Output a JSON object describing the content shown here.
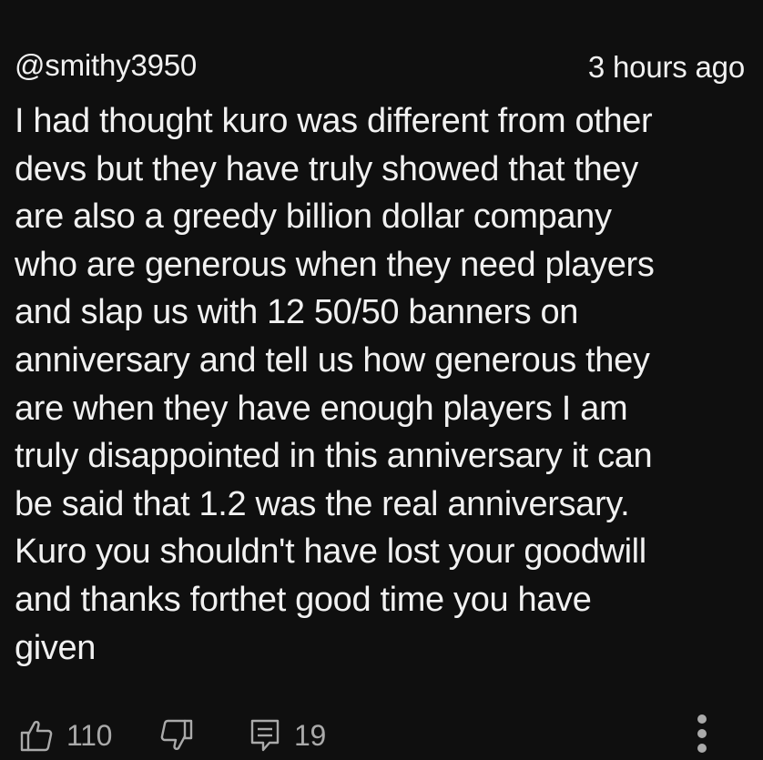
{
  "comment": {
    "author": "@smithy3950",
    "timestamp": "3 hours ago",
    "text": "I had thought kuro was different from other\ndevs but they have truly showed that they\nare also a greedy billion dollar company\nwho are generous when they need players\nand slap us with 12 50/50 banners on\nanniversary and tell us how generous they\nare when they have enough players I am\ntruly disappointed in this anniversary it can\nbe said that 1.2 was the real anniversary.\nKuro you shouldn't have lost your goodwill\nand thanks forthet good time you have\ngiven",
    "actions": {
      "like_icon": "thumbs-up-icon",
      "like_count": "110",
      "dislike_icon": "thumbs-down-icon",
      "reply_icon": "reply-comment-icon",
      "reply_count": "19",
      "more_icon": "more-vertical-icon"
    }
  },
  "colors": {
    "background": "#0f0f0f",
    "primary_text": "#f1f1f1",
    "secondary_text": "#aaaaaa"
  }
}
